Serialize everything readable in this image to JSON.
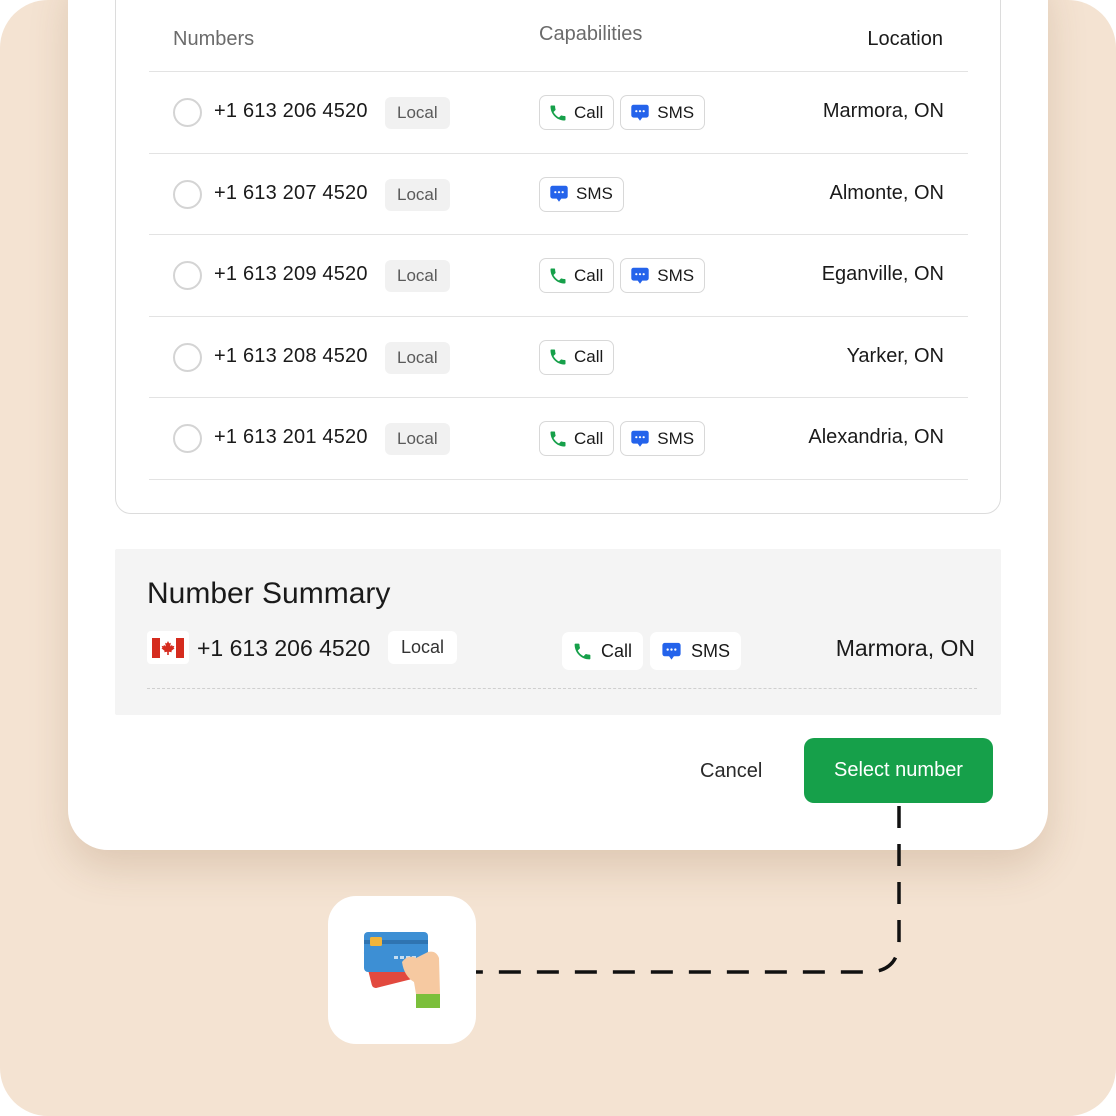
{
  "table": {
    "headers": {
      "numbers": "Numbers",
      "capabilities": "Capabilities",
      "location": "Location"
    },
    "rows": [
      {
        "number": "+1 613 206 4520",
        "type": "Local",
        "call": "Call",
        "sms": "SMS",
        "location": "Marmora, ON"
      },
      {
        "number": "+1 613 207 4520",
        "type": "Local",
        "call": "",
        "sms": "SMS",
        "location": "Almonte, ON"
      },
      {
        "number": "+1 613 209 4520",
        "type": "Local",
        "call": "Call",
        "sms": "SMS",
        "location": "Eganville, ON"
      },
      {
        "number": "+1 613 208 4520",
        "type": "Local",
        "call": "Call",
        "sms": "",
        "location": "Yarker, ON"
      },
      {
        "number": "+1 613 201 4520",
        "type": "Local",
        "call": "Call",
        "sms": "SMS",
        "location": "Alexandria, ON"
      }
    ]
  },
  "summary": {
    "title": "Number Summary",
    "flag": "canada-flag-icon",
    "number": "+1 613 206 4520",
    "type": "Local",
    "call": "Call",
    "sms": "SMS",
    "location": "Marmora, ON"
  },
  "actions": {
    "cancel_label": "Cancel",
    "select_label": "Select number"
  },
  "icons": {
    "call": "phone-icon",
    "sms": "chat-bubble-icon",
    "app": "payment-card-hand-icon"
  },
  "colors": {
    "background": "#f4e3d2",
    "primary": "#16a04a",
    "call_icon": "#16a04a",
    "sms_icon": "#2463eb",
    "flag_red": "#d52b1e"
  }
}
